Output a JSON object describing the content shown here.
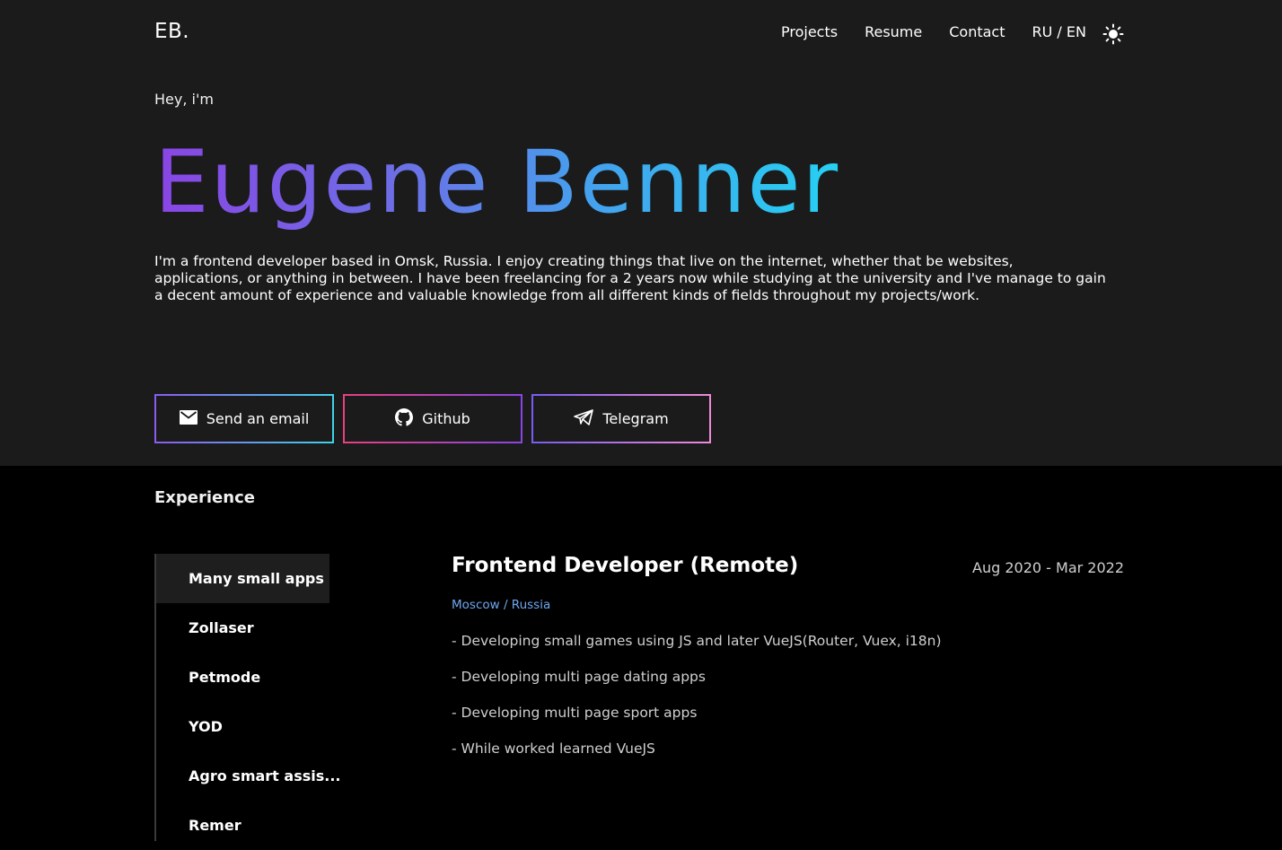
{
  "header": {
    "logo": "EB.",
    "nav": [
      "Projects",
      "Resume",
      "Contact",
      "RU / EN"
    ],
    "theme_icon": "sun-icon"
  },
  "hero": {
    "greeting": "Hey, i'm",
    "name": "Eugene Benner",
    "bio": "I'm a frontend developer based in Omsk, Russia. I enjoy creating things that live on the internet, whether that be websites, applications, or anything in between. I have been freelancing for a 2 years now while studying at the university and I've manage to gain a decent amount of experience and valuable knowledge from all different kinds of fields throughout my projects/work.",
    "buttons": [
      {
        "label": "Send an email",
        "icon": "mail-icon"
      },
      {
        "label": "Github",
        "icon": "github-icon"
      },
      {
        "label": "Telegram",
        "icon": "telegram-icon"
      }
    ],
    "colors": {
      "gradient_start": "#8a45e4",
      "gradient_end": "#26d0f2"
    }
  },
  "experience": {
    "title": "Experience",
    "tabs": [
      "Many small apps",
      "Zollaser",
      "Petmode",
      "YOD",
      "Agro smart assis...",
      "Remer"
    ],
    "active_tab": "Many small apps",
    "job": {
      "title": "Frontend Developer (Remote)",
      "dates": "Aug 2020 - Mar 2022",
      "location": "Moscow / Russia",
      "tasks": [
        "- Developing small games using JS and later VueJS(Router, Vuex, i18n)",
        "- Developing multi page dating apps",
        "- Developing multi page sport apps",
        "- While worked learned VueJS"
      ]
    }
  }
}
